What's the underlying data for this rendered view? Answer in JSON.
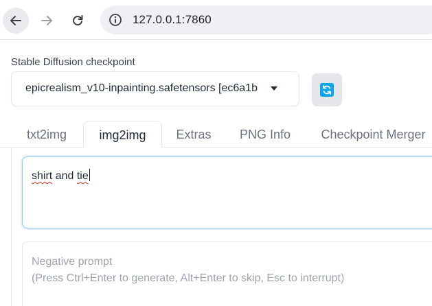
{
  "browser": {
    "url": "127.0.0.1:7860",
    "icons": {
      "back": "arrow-left-icon",
      "forward": "arrow-right-icon",
      "reload": "reload-icon",
      "site_info": "info-circle-icon"
    }
  },
  "checkpoint": {
    "label": "Stable Diffusion checkpoint",
    "selected": "epicrealism_v10-inpainting.safetensors [ec6a1b",
    "refresh_icon": "refresh-icon",
    "refresh_color": "#0ea5e9"
  },
  "tabs": [
    {
      "label": "txt2img",
      "active": false
    },
    {
      "label": "img2img",
      "active": true
    },
    {
      "label": "Extras",
      "active": false
    },
    {
      "label": "PNG Info",
      "active": false
    },
    {
      "label": "Checkpoint Merger",
      "active": false
    }
  ],
  "prompt": {
    "word1": "shirt",
    "word2": " and ",
    "word3": "tie"
  },
  "negative_prompt": {
    "placeholder_line1": "Negative prompt",
    "placeholder_line2": "(Press Ctrl+Enter to generate, Alt+Enter to skip, Esc to interrupt)"
  }
}
